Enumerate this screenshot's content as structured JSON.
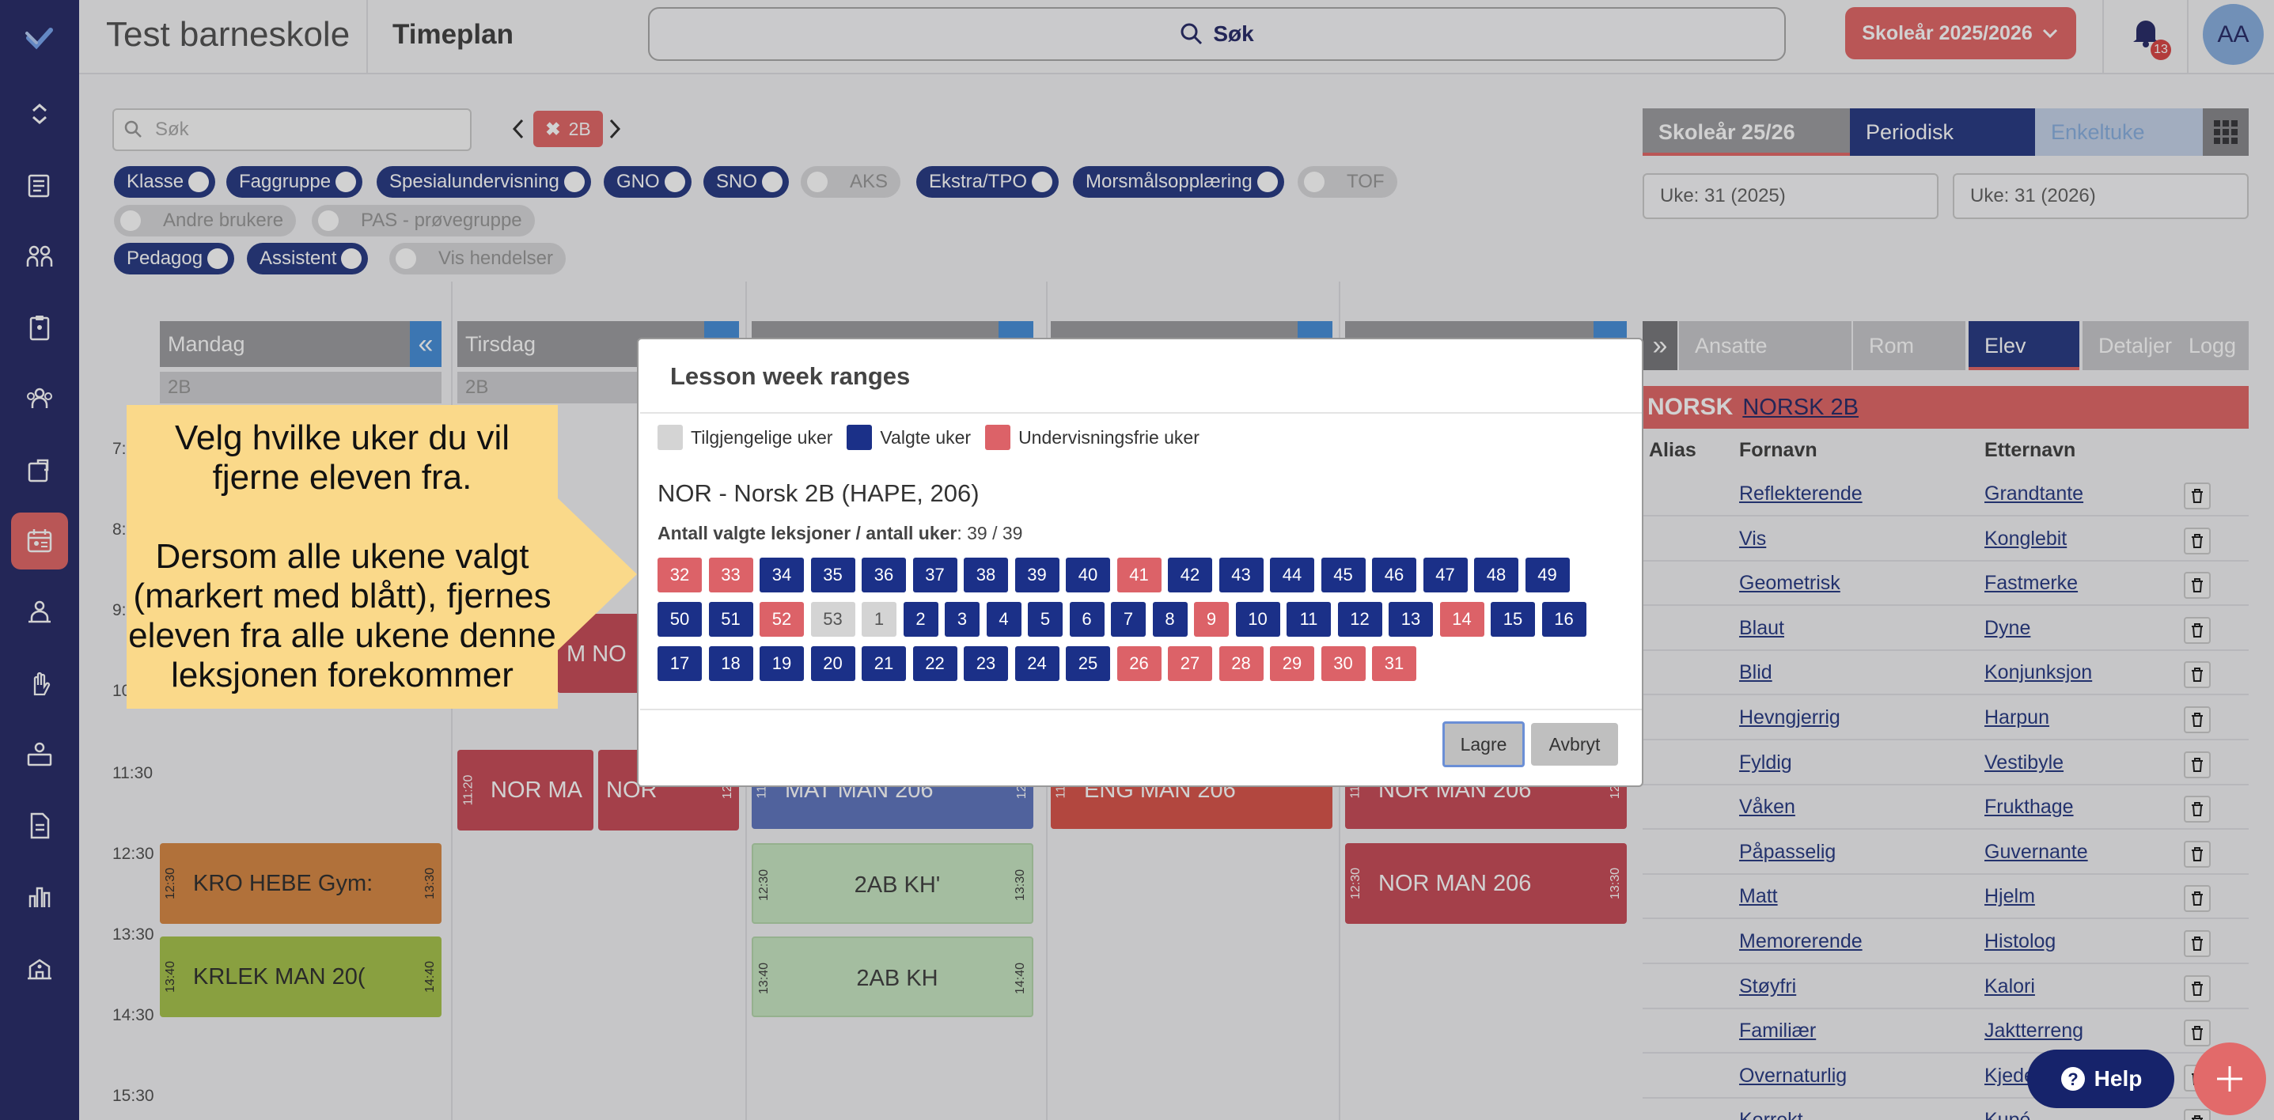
{
  "topbar": {
    "school_name": "Test barneskole",
    "page_title": "Timeplan",
    "search_label": "Søk",
    "year_button": "Skoleår 2025/2026",
    "notification_count": "13",
    "avatar_initials": "AA"
  },
  "filters": {
    "search_placeholder": "Søk",
    "selected_class": "2B",
    "toggles": [
      {
        "label": "Klasse",
        "on": true
      },
      {
        "label": "Faggruppe",
        "on": true
      },
      {
        "label": "Spesialundervisning",
        "on": true
      },
      {
        "label": "GNO",
        "on": true
      },
      {
        "label": "SNO",
        "on": true
      },
      {
        "label": "AKS",
        "on": false
      },
      {
        "label": "Ekstra/TPO",
        "on": true
      },
      {
        "label": "Morsmålsopplæring",
        "on": true
      },
      {
        "label": "TOF",
        "on": false
      },
      {
        "label": "Andre brukere",
        "on": false
      },
      {
        "label": "PAS - prøvegruppe",
        "on": false
      },
      {
        "label": "Pedagog",
        "on": true
      },
      {
        "label": "Assistent",
        "on": true
      },
      {
        "label": "Vis hendelser",
        "on": false
      }
    ]
  },
  "period_tabs": {
    "year": "Skoleår 25/26",
    "periodic": "Periodisk",
    "single_week": "Enkeltuke",
    "week_from": "Uke: 31 (2025)",
    "week_to": "Uke: 31 (2026)"
  },
  "calendar": {
    "days": [
      "Mandag",
      "Tirsdag"
    ],
    "collapse_glyph": "«",
    "group_label": "2B",
    "times": [
      "7:",
      "8:",
      "9:",
      "10:",
      "11:30",
      "12:30",
      "13:30",
      "14:30",
      "15:30"
    ],
    "lessons": {
      "mon_kro": {
        "start": "12:30",
        "end": "13:30",
        "text": "KRO   HEBE    Gym:"
      },
      "mon_krlek": {
        "start": "13:40",
        "end": "14:40",
        "text": "KRLEK   MAN    20("
      },
      "tue_nor_a": {
        "start": "11:20",
        "end": "",
        "text": "NOR    MA"
      },
      "tue_nor_b": {
        "start": "",
        "end": "12:",
        "text": "NOR"
      },
      "tue_nor_c": {
        "text": "M  NO"
      },
      "wed_mat": {
        "start": "11:",
        "end": "12:",
        "text": "MAT    MAN          206"
      },
      "wed_kh1": {
        "start": "12:30",
        "end": "13:30",
        "text": "2AB KH'"
      },
      "wed_kh2": {
        "start": "13:40",
        "end": "14:40",
        "text": "2AB KH"
      },
      "thu_eng": {
        "start": "11:",
        "end": "",
        "text": "ENG    MAN          206"
      },
      "fri_nor1": {
        "start": "11:",
        "end": "12:",
        "text": "NOR    MAN          206"
      },
      "fri_nor2": {
        "start": "12:30",
        "end": "13:30",
        "text": "NOR    MAN          206"
      }
    }
  },
  "panel": {
    "expand_glyph": "»",
    "tabs": [
      "Ansatte",
      "Rom",
      "Elev",
      "Detaljer",
      "Logg"
    ],
    "subject_code": "NORSK",
    "subject_group": "NORSK 2B",
    "columns": [
      "Alias",
      "Fornavn",
      "Etternavn"
    ],
    "students": [
      {
        "first": "Reflekterende",
        "last": "Grandtante"
      },
      {
        "first": "Vis",
        "last": "Konglebit"
      },
      {
        "first": "Geometrisk",
        "last": "Fastmerke"
      },
      {
        "first": "Blaut",
        "last": "Dyne"
      },
      {
        "first": "Blid",
        "last": "Konjunksjon"
      },
      {
        "first": "Hevngjerrig",
        "last": "Harpun"
      },
      {
        "first": "Fyldig",
        "last": "Vestibyle"
      },
      {
        "first": "Våken",
        "last": "Frukthage"
      },
      {
        "first": "Påpasselig",
        "last": "Guvernante"
      },
      {
        "first": "Matt",
        "last": "Hjelm"
      },
      {
        "first": "Memorerende",
        "last": "Histolog"
      },
      {
        "first": "Støyfri",
        "last": "Kalori"
      },
      {
        "first": "Familiær",
        "last": "Jaktterreng"
      },
      {
        "first": "Overnaturlig",
        "last": "Kjede"
      },
      {
        "first": "Korrekt",
        "last": "Kupé"
      }
    ]
  },
  "modal": {
    "title": "Lesson week ranges",
    "legend": [
      "Tilgjengelige uker",
      "Valgte uker",
      "Undervisningsfrie uker"
    ],
    "lesson_name": "NOR - Norsk 2B (HAPE, 206)",
    "count_label": "Antall valgte leksjoner / antall uker",
    "count_value": ": 39 / 39",
    "weeks": [
      [
        [
          "32",
          "h"
        ],
        [
          "33",
          "h"
        ],
        [
          "34",
          "s"
        ],
        [
          "35",
          "s"
        ],
        [
          "36",
          "s"
        ],
        [
          "37",
          "s"
        ],
        [
          "38",
          "s"
        ],
        [
          "39",
          "s"
        ],
        [
          "40",
          "s"
        ],
        [
          "41",
          "h"
        ],
        [
          "42",
          "s"
        ],
        [
          "43",
          "s"
        ],
        [
          "44",
          "s"
        ],
        [
          "45",
          "s"
        ],
        [
          "46",
          "s"
        ],
        [
          "47",
          "s"
        ],
        [
          "48",
          "s"
        ],
        [
          "49",
          "s"
        ]
      ],
      [
        [
          "50",
          "s"
        ],
        [
          "51",
          "s"
        ],
        [
          "52",
          "h"
        ],
        [
          "53",
          "a"
        ],
        [
          "1",
          "a"
        ],
        [
          "2",
          "s"
        ],
        [
          "3",
          "s"
        ],
        [
          "4",
          "s"
        ],
        [
          "5",
          "s"
        ],
        [
          "6",
          "s"
        ],
        [
          "7",
          "s"
        ],
        [
          "8",
          "s"
        ],
        [
          "9",
          "h"
        ],
        [
          "10",
          "s"
        ],
        [
          "11",
          "s"
        ],
        [
          "12",
          "s"
        ],
        [
          "13",
          "s"
        ],
        [
          "14",
          "h"
        ],
        [
          "15",
          "s"
        ],
        [
          "16",
          "s"
        ]
      ],
      [
        [
          "17",
          "s"
        ],
        [
          "18",
          "s"
        ],
        [
          "19",
          "s"
        ],
        [
          "20",
          "s"
        ],
        [
          "21",
          "s"
        ],
        [
          "22",
          "s"
        ],
        [
          "23",
          "s"
        ],
        [
          "24",
          "s"
        ],
        [
          "25",
          "s"
        ],
        [
          "26",
          "h"
        ],
        [
          "27",
          "h"
        ],
        [
          "28",
          "h"
        ],
        [
          "29",
          "h"
        ],
        [
          "30",
          "h"
        ],
        [
          "31",
          "h"
        ]
      ]
    ],
    "save_label": "Lagre",
    "cancel_label": "Avbryt"
  },
  "callout": {
    "line1": "Velg hvilke uker du vil fjerne eleven fra.",
    "line2": "Dersom alle ukene valgt (markert med blått), fjernes eleven fra alle ukene denne leksjonen forekommer"
  },
  "help_label": "Help",
  "colors": {
    "sidebar": "#2b2f6b",
    "accent": "#e26a6a",
    "selected_week": "#1b3088",
    "holiday_week": "#dc6268",
    "available_week": "#d4d4d4",
    "callout": "#fad98a"
  }
}
